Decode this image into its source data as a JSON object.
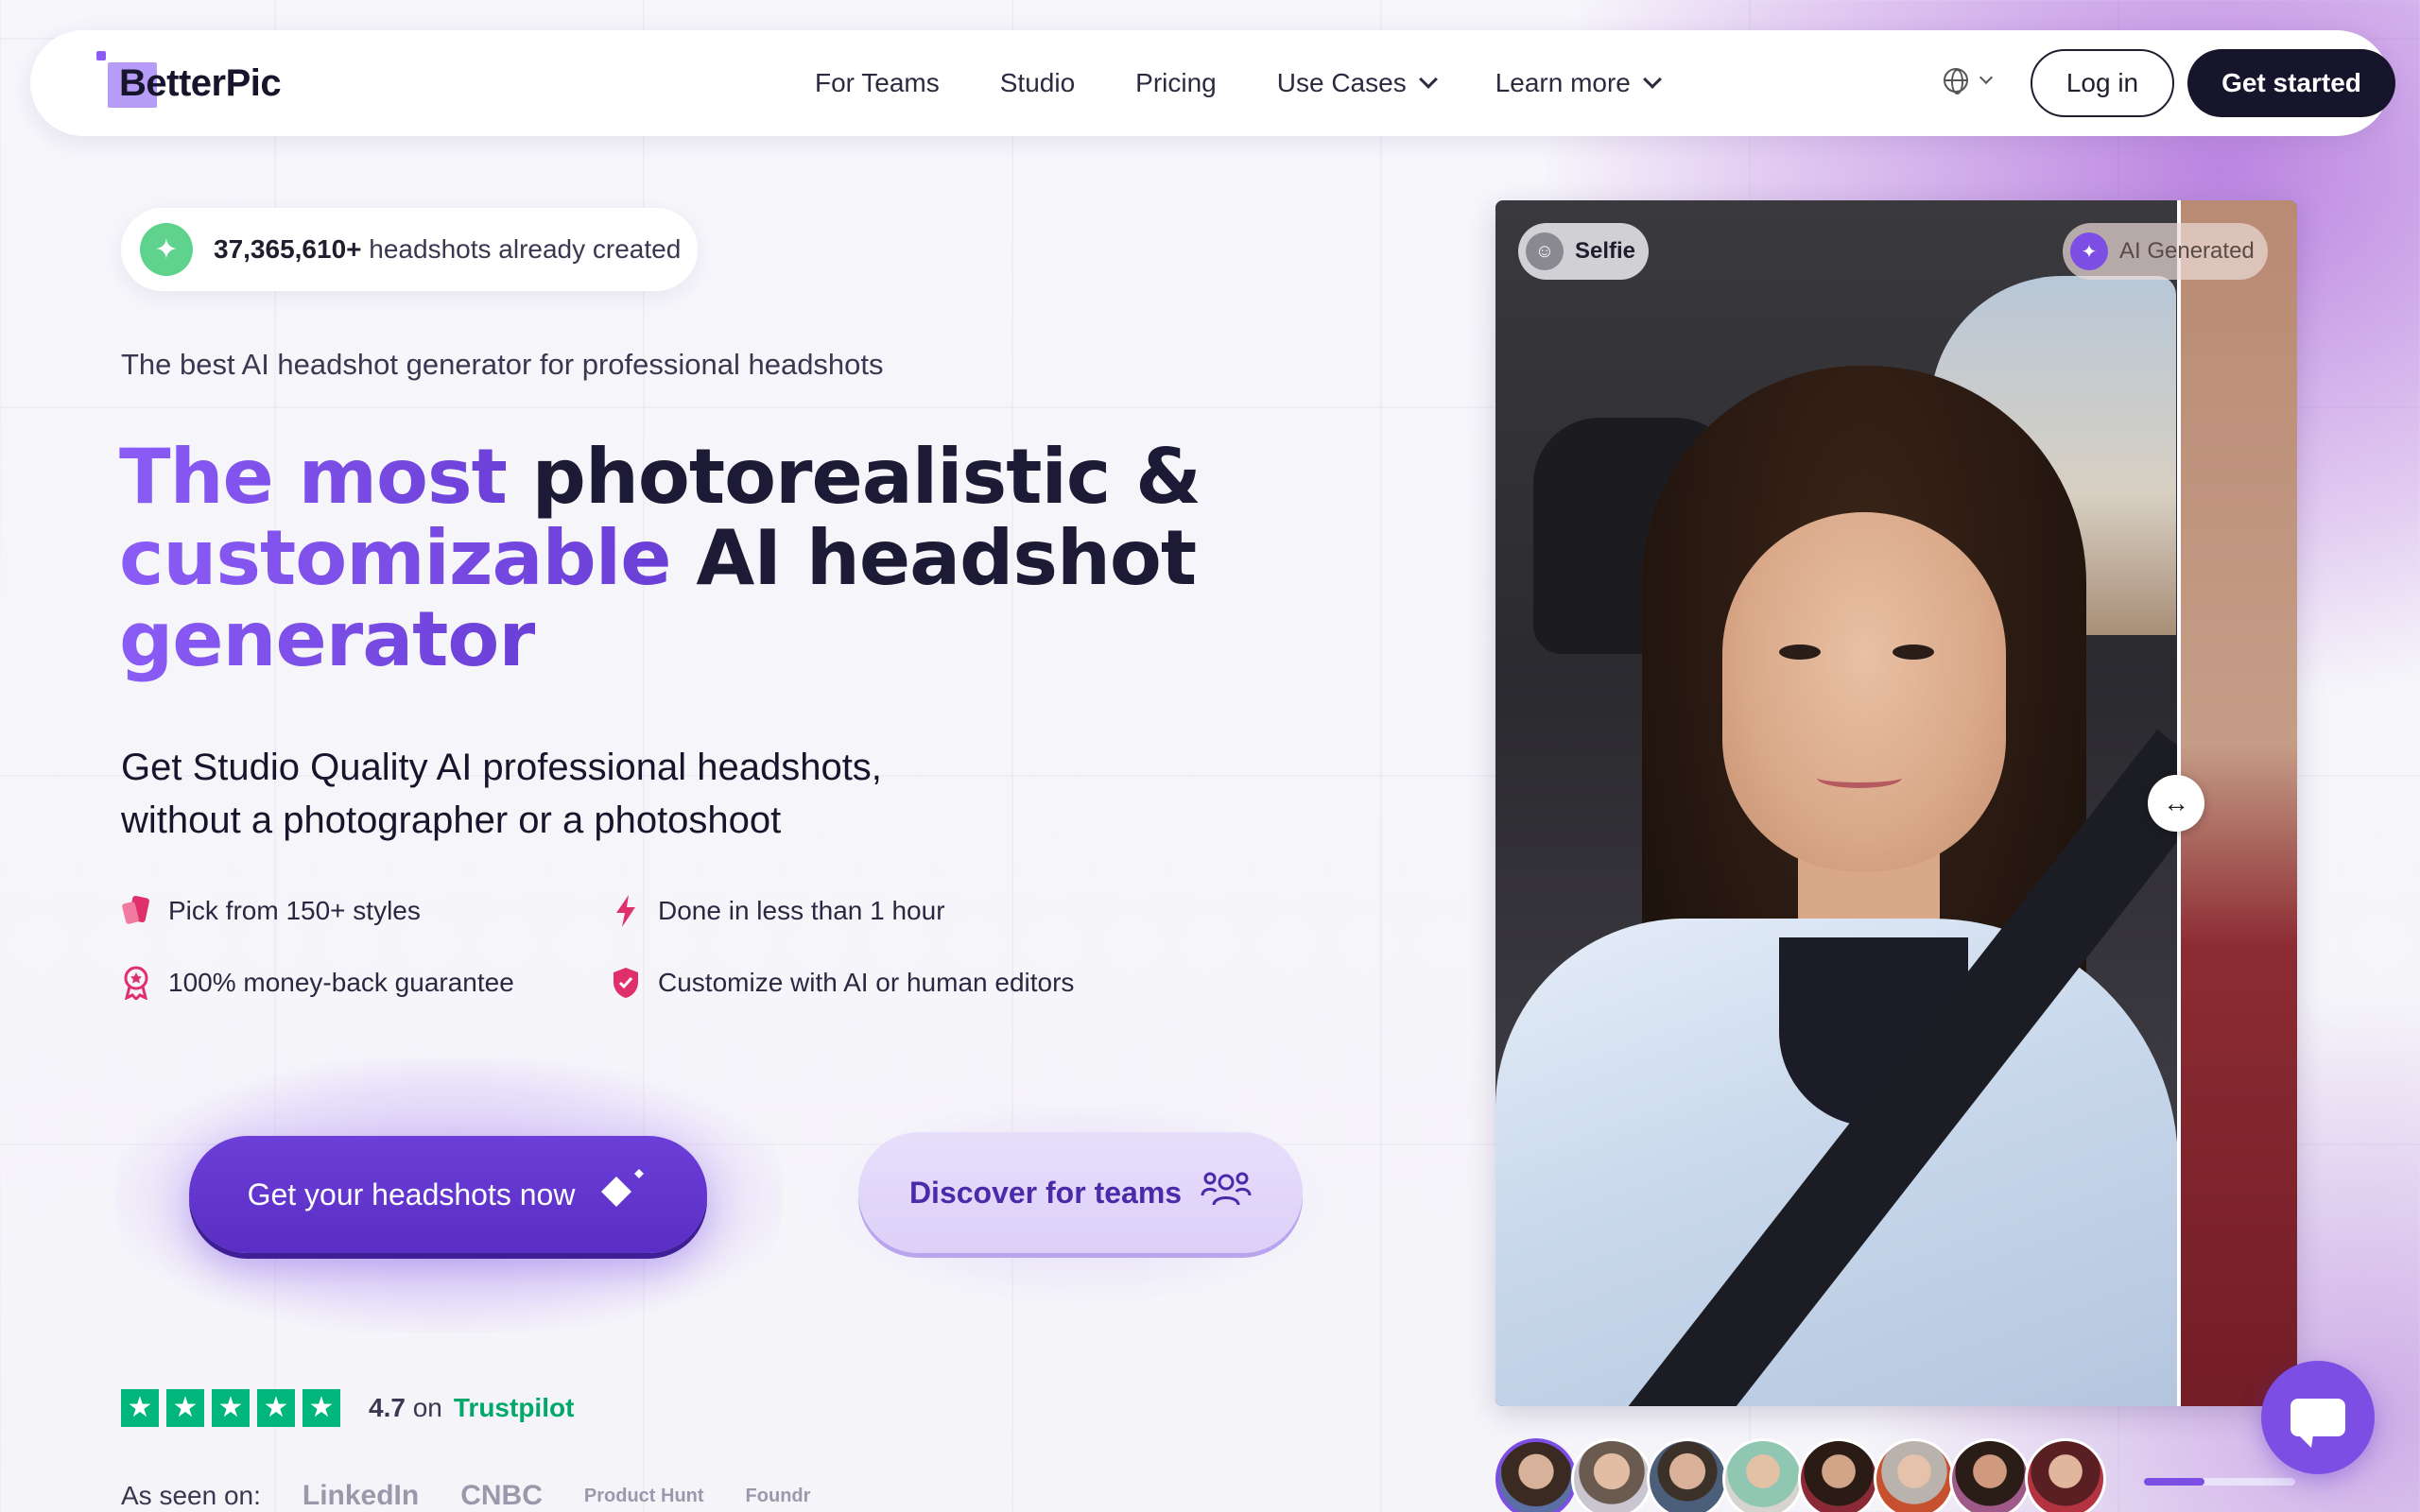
{
  "nav": {
    "logo_text": "BetterPic",
    "links": [
      {
        "label": "For Teams"
      },
      {
        "label": "Studio"
      },
      {
        "label": "Pricing"
      },
      {
        "label": "Use Cases"
      },
      {
        "label": "Learn more"
      }
    ],
    "login_label": "Log in",
    "get_started_label": "Get started"
  },
  "hero": {
    "badge_count": "37,365,610+",
    "badge_text": "headshots already created",
    "tagline": "The best AI headshot generator for professional headshots",
    "headline_part1": "The most photorealistic &",
    "headline_part2a": "customizable",
    "headline_part2b": "AI headshot",
    "headline_part3": "generator",
    "subhead_line1": "Get Studio Quality AI professional headshots,",
    "subhead_line2": "without a photographer or a photoshoot",
    "features": [
      {
        "label": "Pick from 150+ styles"
      },
      {
        "label": "Done in less than 1 hour"
      },
      {
        "label": "100% money-back guarantee"
      },
      {
        "label": "Customize with AI or human editors"
      }
    ],
    "cta_primary": "Get your headshots now",
    "cta_secondary": "Discover for teams"
  },
  "trust": {
    "rating": "4.7",
    "on": "on",
    "brand": "Trustpilot",
    "stars": 5
  },
  "seen": {
    "label": "As seen on:",
    "logos": [
      "LinkedIn",
      "CNBC",
      "Product Hunt",
      "Foundr"
    ]
  },
  "comparison": {
    "selfie_label": "Selfie",
    "ai_label": "AI Generated",
    "slider_glyph": "↔",
    "carousel_progress": 0.4
  },
  "colors": {
    "accent": "#7c4ee4",
    "primary_dark": "#17152b",
    "trustpilot_green": "#00b67a",
    "feature_pink": "#e0306b"
  }
}
